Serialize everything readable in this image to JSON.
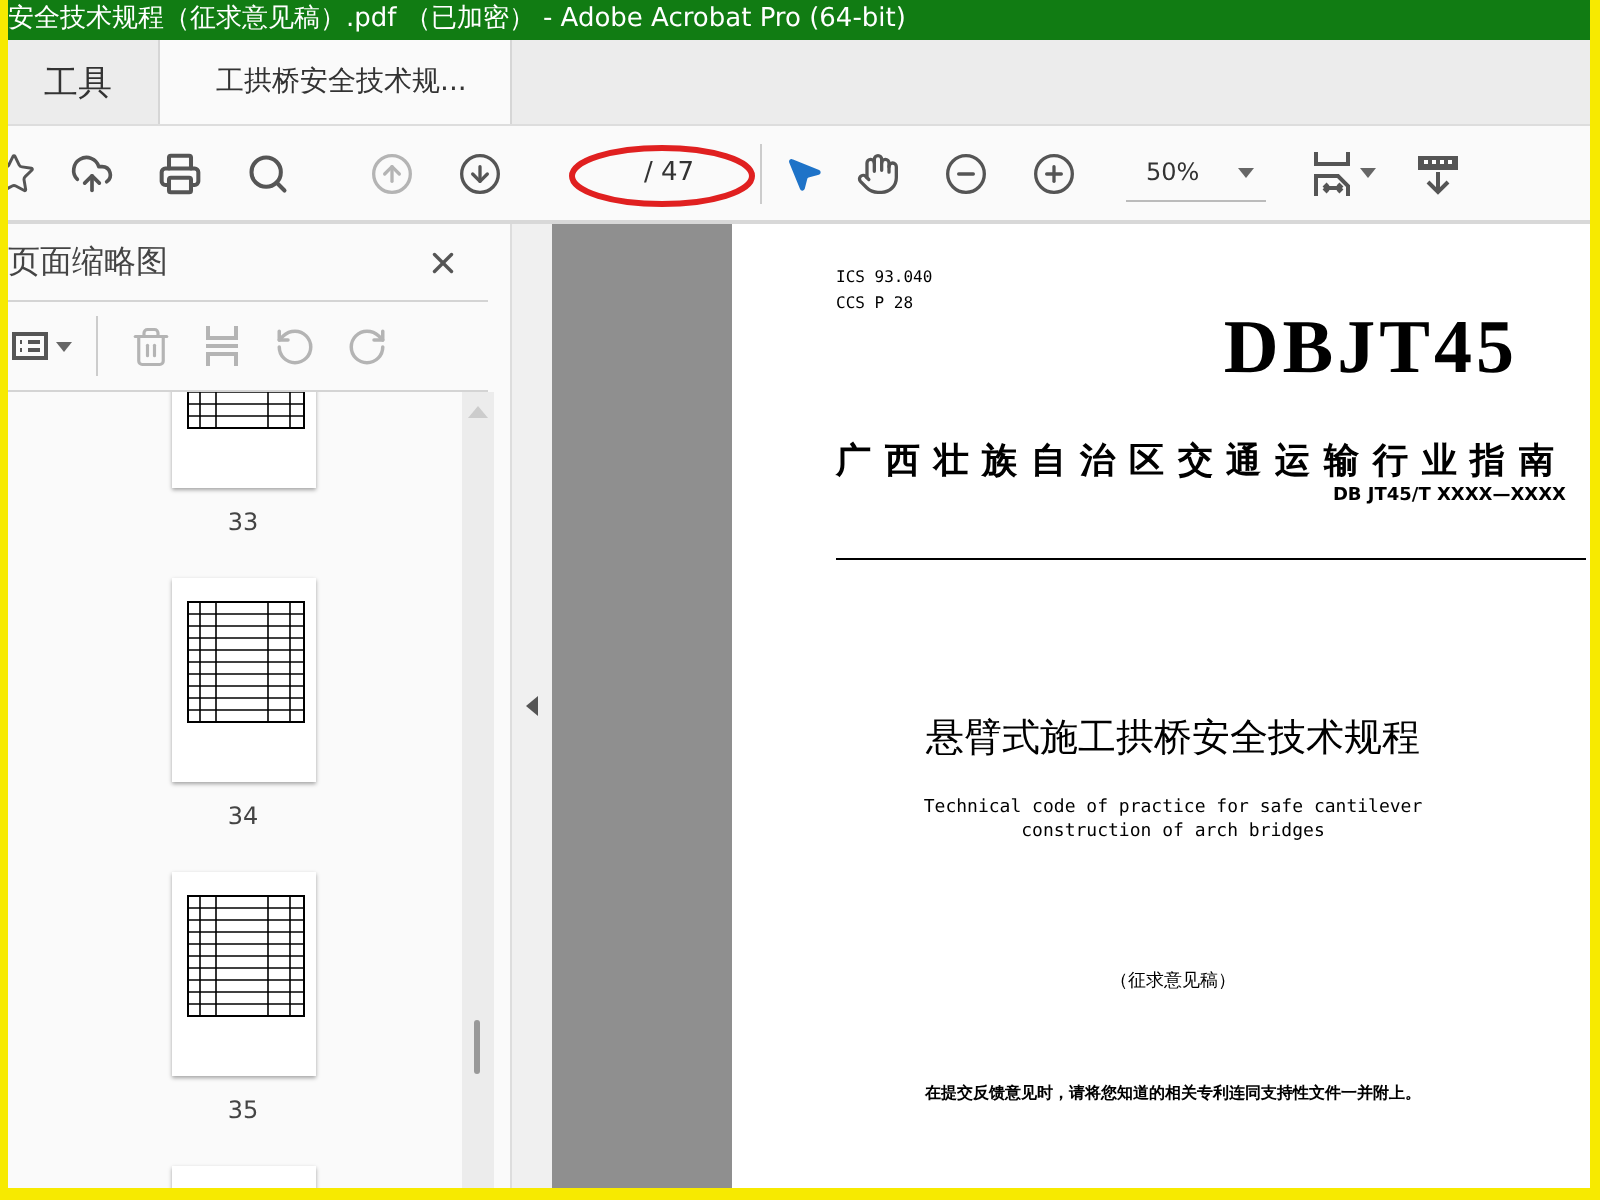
{
  "window": {
    "title": "安全技术规程（征求意见稿）.pdf （已加密） - Adobe Acrobat Pro (64-bit)"
  },
  "tabs": [
    {
      "label": "工具",
      "selected": false
    },
    {
      "label": "工拱桥安全技术规...",
      "selected": true
    }
  ],
  "toolbar": {
    "prev_page": {
      "disabled": true
    },
    "next_page": {
      "disabled": false
    },
    "page_total": "/ 47",
    "zoom": "50%"
  },
  "sidebar": {
    "title": "页面缩略图",
    "tools": {
      "delete": {
        "disabled": true
      },
      "extract": {
        "disabled": true
      },
      "undo": {
        "disabled": true
      },
      "redo": {
        "disabled": true
      }
    },
    "thumbnails": [
      {
        "label": "33"
      },
      {
        "label": "34"
      },
      {
        "label": "35"
      }
    ],
    "next_thumbnail_visible": true
  },
  "document": {
    "ics": "ICS  93.040",
    "ccs": "CCS  P 28",
    "code_mark": "DBJT45",
    "category": "广西壮族自治区交通运输行业指南",
    "number": "DB JT45/T XXXX—XXXX",
    "title": "悬臂式施工拱桥安全技术规程",
    "english_title": [
      "Technical code of practice for safe cantilever",
      "construction of arch bridges"
    ],
    "draft": "（征求意见稿）",
    "note": "在提交反馈意见时，请将您知道的相关专利连同支持性文件一并附上。"
  }
}
